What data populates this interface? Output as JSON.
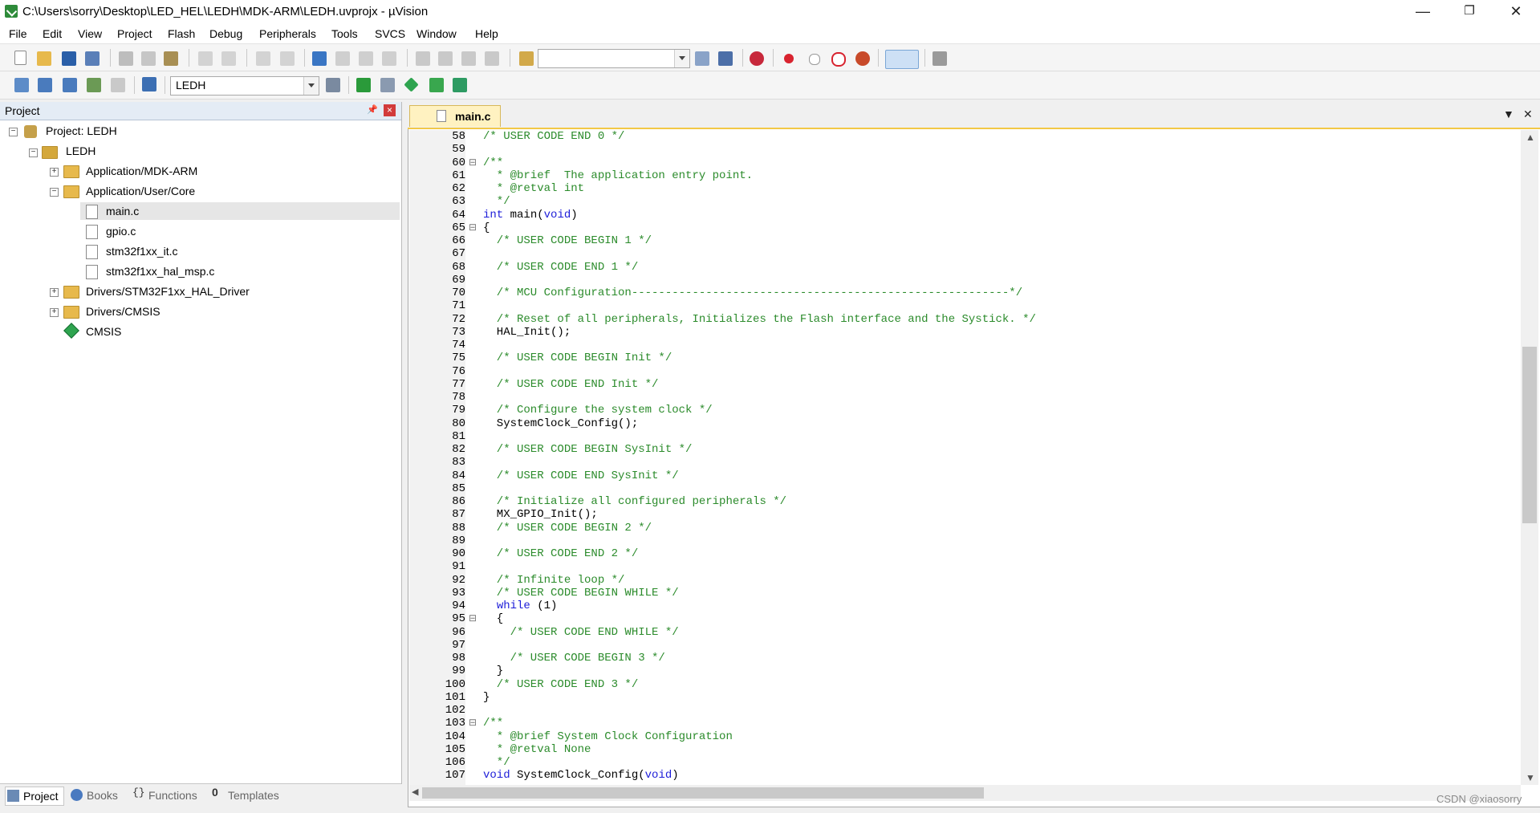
{
  "window": {
    "title": "C:\\Users\\sorry\\Desktop\\LED_HEL\\LEDH\\MDK-ARM\\LEDH.uvprojx - µVision",
    "minimize": "—",
    "maximize": "❐",
    "close": "✕"
  },
  "menu": [
    "File",
    "Edit",
    "View",
    "Project",
    "Flash",
    "Debug",
    "Peripherals",
    "Tools",
    "SVCS",
    "Window",
    "Help"
  ],
  "toolbar": {
    "target_select": "LEDH"
  },
  "project_panel": {
    "title": "Project",
    "tree": [
      {
        "label": "Project: LEDH"
      },
      {
        "label": "LEDH"
      },
      {
        "label": "Application/MDK-ARM"
      },
      {
        "label": "Application/User/Core"
      },
      {
        "label": "main.c"
      },
      {
        "label": "gpio.c"
      },
      {
        "label": "stm32f1xx_it.c"
      },
      {
        "label": "stm32f1xx_hal_msp.c"
      },
      {
        "label": "Drivers/STM32F1xx_HAL_Driver"
      },
      {
        "label": "Drivers/CMSIS"
      },
      {
        "label": "CMSIS"
      }
    ],
    "tabs": [
      "Project",
      "Books",
      "Functions",
      "Templates"
    ]
  },
  "editor": {
    "active_tab": "main.c",
    "lines": [
      {
        "n": "58",
        "code": "/* USER CODE END 0 */"
      },
      {
        "n": "59",
        "code": ""
      },
      {
        "n": "60",
        "code": "/**"
      },
      {
        "n": "61",
        "code": "  * @brief  The application entry point."
      },
      {
        "n": "62",
        "code": "  * @retval int"
      },
      {
        "n": "63",
        "code": "  */"
      },
      {
        "n": "64",
        "code": "int main(void)"
      },
      {
        "n": "65",
        "code": "{"
      },
      {
        "n": "66",
        "code": "  /* USER CODE BEGIN 1 */"
      },
      {
        "n": "67",
        "code": ""
      },
      {
        "n": "68",
        "code": "  /* USER CODE END 1 */"
      },
      {
        "n": "69",
        "code": ""
      },
      {
        "n": "70",
        "code": "  /* MCU Configuration--------------------------------------------------------*/"
      },
      {
        "n": "71",
        "code": ""
      },
      {
        "n": "72",
        "code": "  /* Reset of all peripherals, Initializes the Flash interface and the Systick. */"
      },
      {
        "n": "73",
        "code": "  HAL_Init();"
      },
      {
        "n": "74",
        "code": ""
      },
      {
        "n": "75",
        "code": "  /* USER CODE BEGIN Init */"
      },
      {
        "n": "76",
        "code": ""
      },
      {
        "n": "77",
        "code": "  /* USER CODE END Init */"
      },
      {
        "n": "78",
        "code": ""
      },
      {
        "n": "79",
        "code": "  /* Configure the system clock */"
      },
      {
        "n": "80",
        "code": "  SystemClock_Config();"
      },
      {
        "n": "81",
        "code": ""
      },
      {
        "n": "82",
        "code": "  /* USER CODE BEGIN SysInit */"
      },
      {
        "n": "83",
        "code": ""
      },
      {
        "n": "84",
        "code": "  /* USER CODE END SysInit */"
      },
      {
        "n": "85",
        "code": ""
      },
      {
        "n": "86",
        "code": "  /* Initialize all configured peripherals */"
      },
      {
        "n": "87",
        "code": "  MX_GPIO_Init();"
      },
      {
        "n": "88",
        "code": "  /* USER CODE BEGIN 2 */"
      },
      {
        "n": "89",
        "code": ""
      },
      {
        "n": "90",
        "code": "  /* USER CODE END 2 */"
      },
      {
        "n": "91",
        "code": ""
      },
      {
        "n": "92",
        "code": "  /* Infinite loop */"
      },
      {
        "n": "93",
        "code": "  /* USER CODE BEGIN WHILE */"
      },
      {
        "n": "94",
        "code": "  while (1)"
      },
      {
        "n": "95",
        "code": "  {"
      },
      {
        "n": "96",
        "code": "    /* USER CODE END WHILE */"
      },
      {
        "n": "97",
        "code": ""
      },
      {
        "n": "98",
        "code": "    /* USER CODE BEGIN 3 */"
      },
      {
        "n": "99",
        "code": "  }"
      },
      {
        "n": "100",
        "code": "  /* USER CODE END 3 */"
      },
      {
        "n": "101",
        "code": "}"
      },
      {
        "n": "102",
        "code": ""
      },
      {
        "n": "103",
        "code": "/**"
      },
      {
        "n": "104",
        "code": "  * @brief System Clock Configuration"
      },
      {
        "n": "105",
        "code": "  * @retval None"
      },
      {
        "n": "106",
        "code": "  */"
      },
      {
        "n": "107",
        "code": "void SystemClock_Config(void)"
      }
    ]
  },
  "watermark": "CSDN @xiaosorry",
  "colors": {
    "comment": "#2b8b2b",
    "keyword": "#1d1dd8",
    "tab_active": "#fff2c1",
    "tab_border": "#f2c846"
  }
}
